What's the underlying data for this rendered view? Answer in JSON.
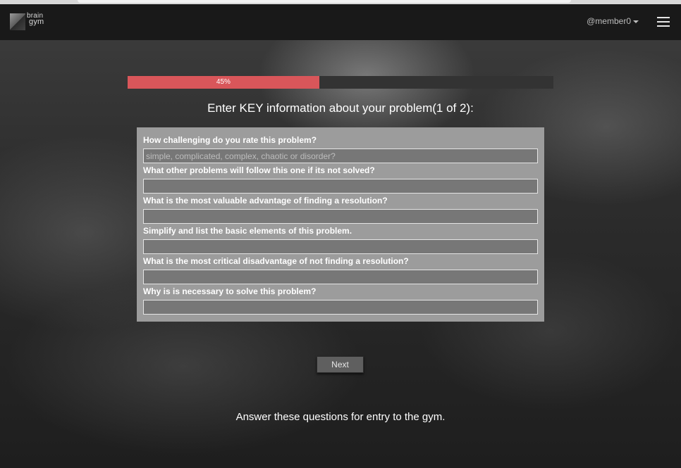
{
  "brand": {
    "logo_line1": "brain",
    "logo_line2": "gym"
  },
  "header": {
    "user_label": "@member0"
  },
  "progress": {
    "percent": 45,
    "label": "45%",
    "fill_color": "#d9565a"
  },
  "form": {
    "heading": "Enter KEY information about your problem(1 of 2):",
    "questions": [
      {
        "label": "How challenging do you rate this problem?",
        "value": "",
        "placeholder": "simple, complicated, complex, chaotic or disorder?"
      },
      {
        "label": "What other problems will follow this one if its not solved?",
        "value": "",
        "placeholder": ""
      },
      {
        "label": "What is the most valuable advantage of finding a resolution?",
        "value": "",
        "placeholder": ""
      },
      {
        "label": "Simplify and list the basic elements of this problem.",
        "value": "",
        "placeholder": ""
      },
      {
        "label": "What is the most critical disadvantage of not finding a resolution?",
        "value": "",
        "placeholder": ""
      },
      {
        "label": "Why is is necessary to solve this problem?",
        "value": "",
        "placeholder": ""
      }
    ],
    "next_label": "Next"
  },
  "footer": {
    "note": "Answer these questions for entry to the gym."
  }
}
